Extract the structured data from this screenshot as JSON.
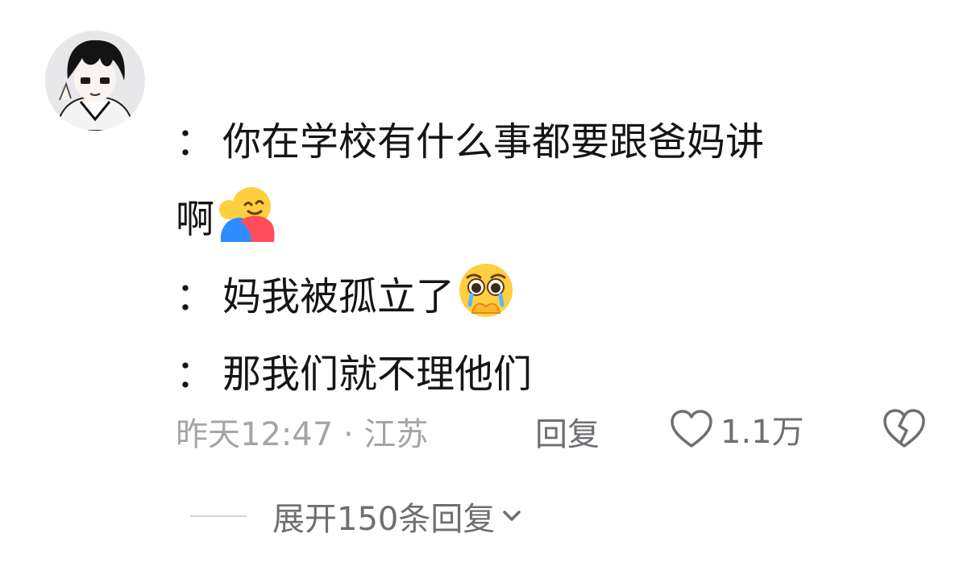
{
  "comment": {
    "avatar_icon": "user-avatar",
    "lines": [
      {
        "speaker_mark": "：",
        "text": "你在学校有什么事都要跟爸妈讲"
      },
      {
        "speaker_mark": "",
        "text": "啊",
        "emoji": "hugging-face"
      },
      {
        "speaker_mark": "：",
        "text": "妈我被孤立了",
        "emoji": "pleading-face"
      },
      {
        "speaker_mark": "：",
        "text": "那我们就不理他们"
      }
    ]
  },
  "meta": {
    "time_location": "昨天12:47 · 江苏",
    "reply_label": "回复",
    "like_count": "1.1万",
    "like_icon": "heart-outline-icon",
    "dislike_icon": "broken-heart-icon"
  },
  "replies": {
    "expand_label": "展开150条回复",
    "expand_icon": "chevron-down-icon"
  },
  "colors": {
    "text": "#151515",
    "meta": "#a5a5a8",
    "action": "#6e6e73",
    "background": "#ffffff"
  }
}
